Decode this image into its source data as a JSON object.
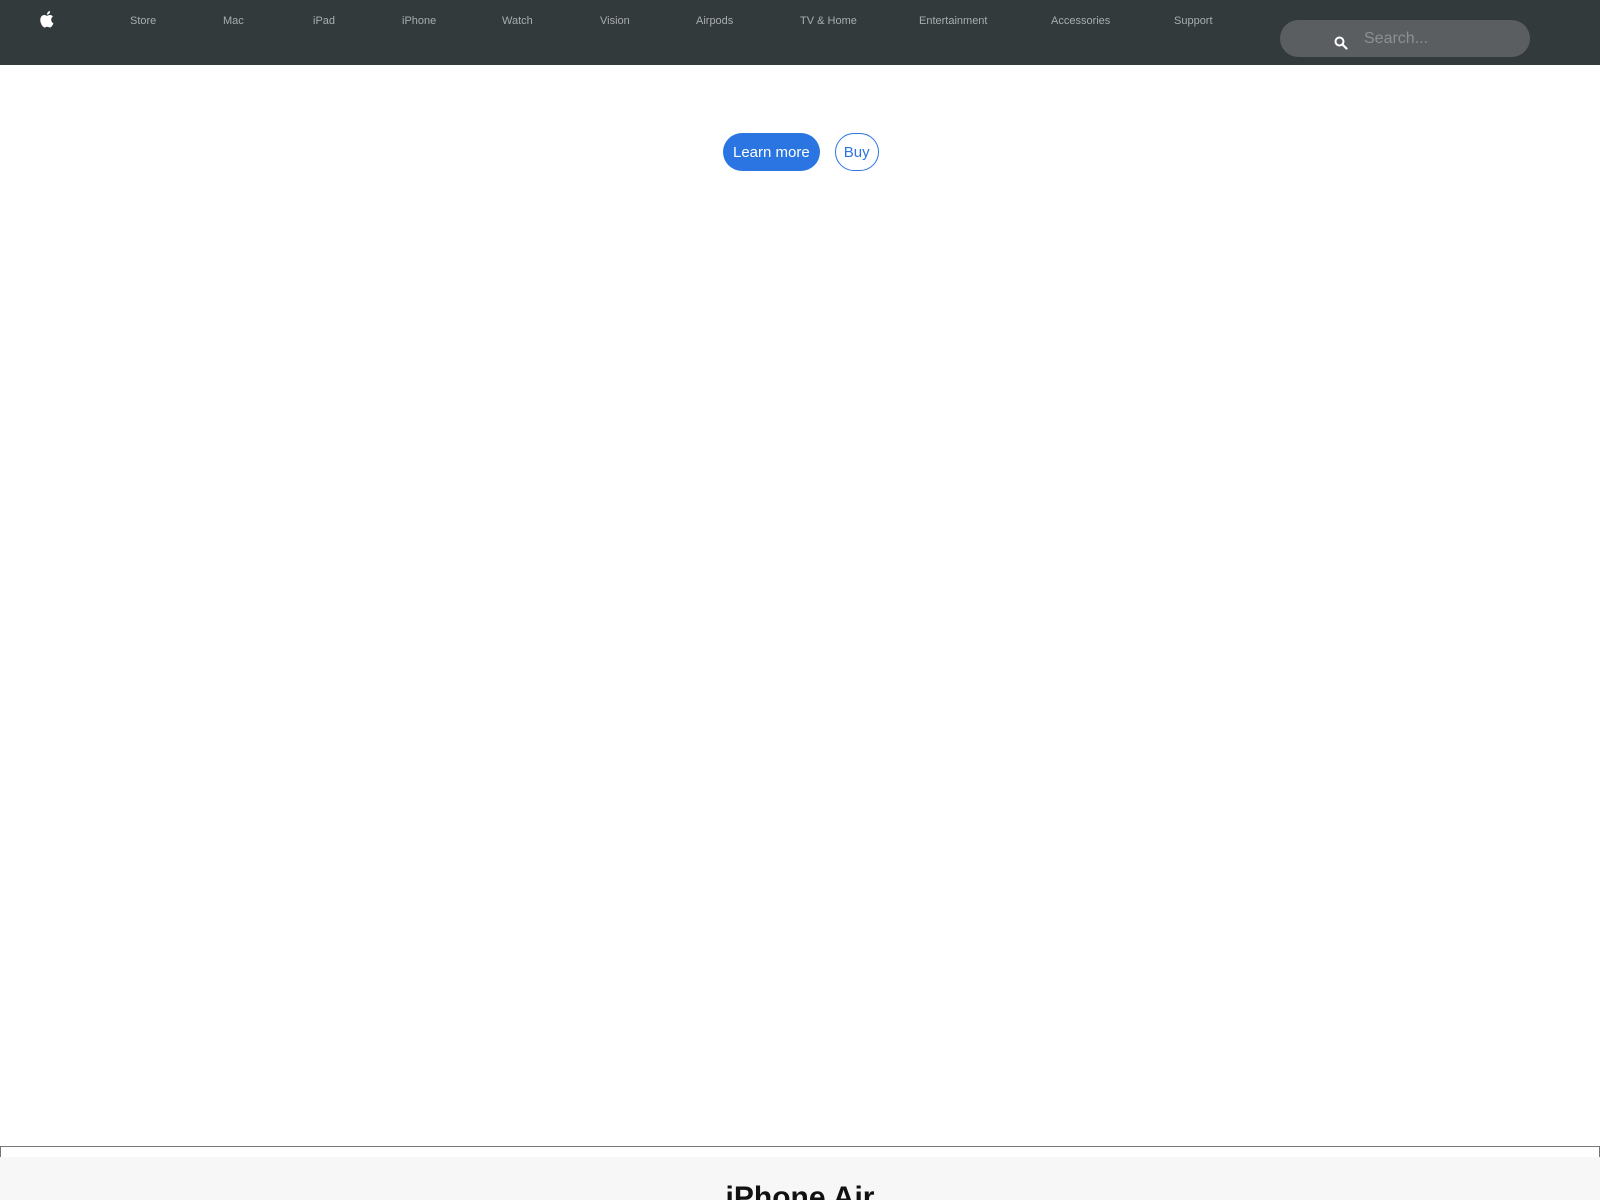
{
  "nav": {
    "logo_icon": "apple-logo-icon",
    "items": [
      {
        "label": "Store"
      },
      {
        "label": "Mac"
      },
      {
        "label": "iPad"
      },
      {
        "label": "iPhone"
      },
      {
        "label": "Watch"
      },
      {
        "label": "Vision"
      },
      {
        "label": "Airpods"
      },
      {
        "label": "TV & Home"
      },
      {
        "label": "Entertainment"
      },
      {
        "label": "Accessories"
      },
      {
        "label": "Support"
      }
    ],
    "search": {
      "icon": "search-icon",
      "placeholder": "Search...",
      "value": ""
    },
    "colors": {
      "background": "#333a3c",
      "search_background": "#5b5e61"
    }
  },
  "hero": {
    "primary_button": "Learn more",
    "secondary_button": "Buy",
    "accent_color": "#2a75e1"
  },
  "next_section": {
    "title": "iPhone Air"
  }
}
